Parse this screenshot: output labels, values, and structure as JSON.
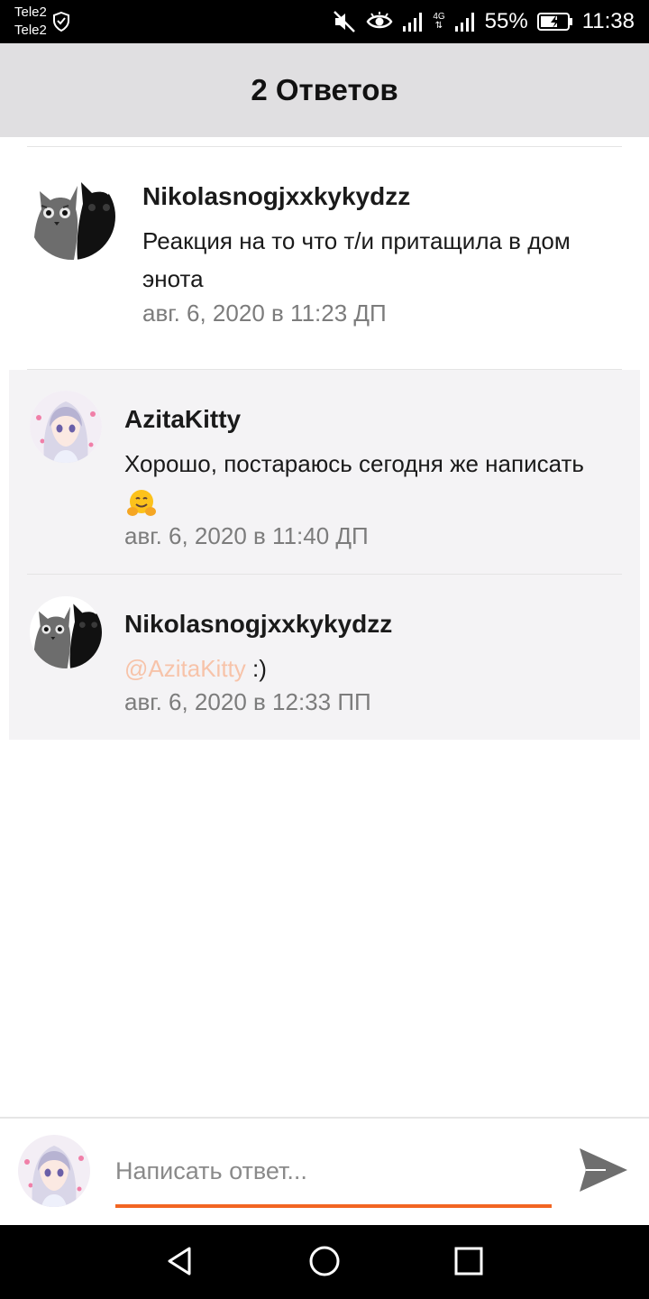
{
  "status_bar": {
    "carrier_1": "Tele2",
    "carrier_2": "Tele2",
    "net_type": "4G",
    "battery": "55%",
    "time": "11:38"
  },
  "header": {
    "title": "2 Ответов"
  },
  "original_comment": {
    "author": "Nikolasnogjxxkykydzz",
    "text": "Реакция на то что т/и притащила в дом энота",
    "time": "авг. 6, 2020 в 11:23 ДП",
    "avatar": "cats-avatar"
  },
  "replies": [
    {
      "author": "AzitaKitty",
      "text": "Хорошо, постараюсь сегодня же написать",
      "emoji": "hugging-face",
      "time": "авг. 6, 2020 в 11:40 ДП",
      "avatar": "anime-girl-avatar"
    },
    {
      "author": "Nikolasnogjxxkykydzz",
      "mention": "@AzitaKitty",
      "text": ":)",
      "time": "авг. 6, 2020 в 12:33 ПП",
      "avatar": "cats-avatar"
    }
  ],
  "composer": {
    "placeholder": "Написать ответ...",
    "accent_color": "#f26522"
  },
  "colors": {
    "header_bg": "#e0dfe1",
    "reply_bg": "#f4f3f5",
    "mention": "#f7c3a9",
    "timestamp": "#7c7c7c"
  }
}
